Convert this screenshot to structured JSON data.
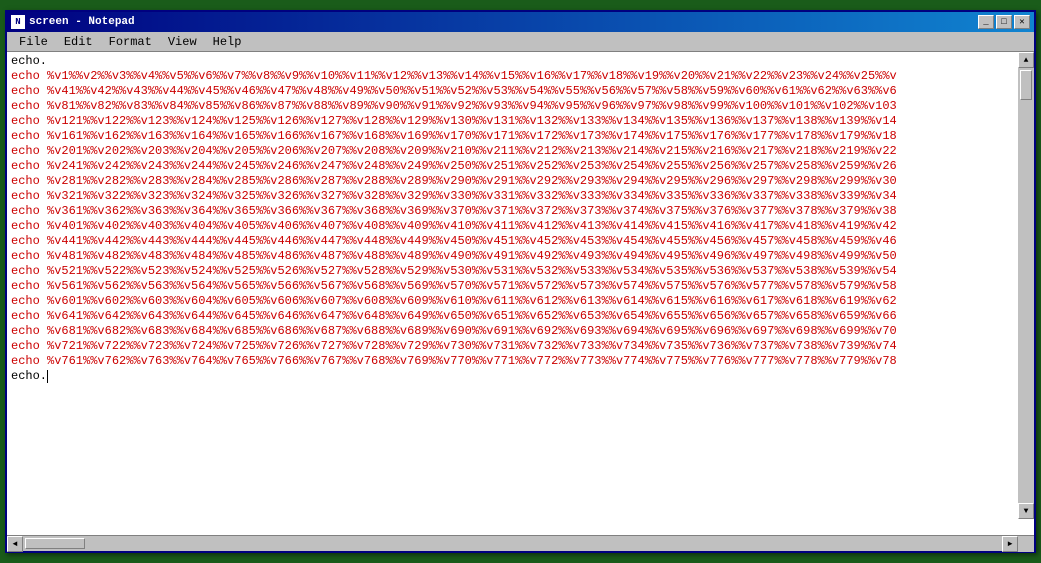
{
  "window": {
    "title": "screen - Notepad",
    "icon": "N"
  },
  "title_buttons": {
    "minimize": "_",
    "restore": "□",
    "close": "✕"
  },
  "menu": {
    "items": [
      "File",
      "Edit",
      "Format",
      "View",
      "Help"
    ]
  },
  "content": {
    "lines": [
      {
        "text": "echo.",
        "red": false
      },
      {
        "text": "echo   %v1%%v2%%v3%%v4%%v5%%v6%%v7%%v8%%v9%%v10%%v11%%v12%%v13%%v14%%v15%%v16%%v17%%v18%%v19%%v20%%v21%%v22%%v23%%v24%%v25%%v",
        "red": true
      },
      {
        "text": "echo   %v41%%v42%%v43%%v44%%v45%%v46%%v47%%v48%%v49%%v50%%v51%%v52%%v53%%v54%%v55%%v56%%v57%%v58%%v59%%v60%%v61%%v62%%v63%%v6",
        "red": true
      },
      {
        "text": "echo   %v81%%v82%%v83%%v84%%v85%%v86%%v87%%v88%%v89%%v90%%v91%%v92%%v93%%v94%%v95%%v96%%v97%%v98%%v99%%v100%%v101%%v102%%v103",
        "red": true
      },
      {
        "text": "echo   %v121%%v122%%v123%%v124%%v125%%v126%%v127%%v128%%v129%%v130%%v131%%v132%%v133%%v134%%v135%%v136%%v137%%v138%%v139%%v14",
        "red": true
      },
      {
        "text": "echo   %v161%%v162%%v163%%v164%%v165%%v166%%v167%%v168%%v169%%v170%%v171%%v172%%v173%%v174%%v175%%v176%%v177%%v178%%v179%%v18",
        "red": true
      },
      {
        "text": "echo   %v201%%v202%%v203%%v204%%v205%%v206%%v207%%v208%%v209%%v210%%v211%%v212%%v213%%v214%%v215%%v216%%v217%%v218%%v219%%v22",
        "red": true
      },
      {
        "text": "echo   %v241%%v242%%v243%%v244%%v245%%v246%%v247%%v248%%v249%%v250%%v251%%v252%%v253%%v254%%v255%%v256%%v257%%v258%%v259%%v26",
        "red": true
      },
      {
        "text": "echo   %v281%%v282%%v283%%v284%%v285%%v286%%v287%%v288%%v289%%v290%%v291%%v292%%v293%%v294%%v295%%v296%%v297%%v298%%v299%%v30",
        "red": true
      },
      {
        "text": "echo   %v321%%v322%%v323%%v324%%v325%%v326%%v327%%v328%%v329%%v330%%v331%%v332%%v333%%v334%%v335%%v336%%v337%%v338%%v339%%v34",
        "red": true
      },
      {
        "text": "echo   %v361%%v362%%v363%%v364%%v365%%v366%%v367%%v368%%v369%%v370%%v371%%v372%%v373%%v374%%v375%%v376%%v377%%v378%%v379%%v38",
        "red": true
      },
      {
        "text": "echo   %v401%%v402%%v403%%v404%%v405%%v406%%v407%%v408%%v409%%v410%%v411%%v412%%v413%%v414%%v415%%v416%%v417%%v418%%v419%%v42",
        "red": true
      },
      {
        "text": "echo   %v441%%v442%%v443%%v444%%v445%%v446%%v447%%v448%%v449%%v450%%v451%%v452%%v453%%v454%%v455%%v456%%v457%%v458%%v459%%v46",
        "red": true
      },
      {
        "text": "echo   %v481%%v482%%v483%%v484%%v485%%v486%%v487%%v488%%v489%%v490%%v491%%v492%%v493%%v494%%v495%%v496%%v497%%v498%%v499%%v50",
        "red": true
      },
      {
        "text": "echo   %v521%%v522%%v523%%v524%%v525%%v526%%v527%%v528%%v529%%v530%%v531%%v532%%v533%%v534%%v535%%v536%%v537%%v538%%v539%%v54",
        "red": true
      },
      {
        "text": "echo   %v561%%v562%%v563%%v564%%v565%%v566%%v567%%v568%%v569%%v570%%v571%%v572%%v573%%v574%%v575%%v576%%v577%%v578%%v579%%v58",
        "red": true
      },
      {
        "text": "echo   %v601%%v602%%v603%%v604%%v605%%v606%%v607%%v608%%v609%%v610%%v611%%v612%%v613%%v614%%v615%%v616%%v617%%v618%%v619%%v62",
        "red": true
      },
      {
        "text": "echo   %v641%%v642%%v643%%v644%%v645%%v646%%v647%%v648%%v649%%v650%%v651%%v652%%v653%%v654%%v655%%v656%%v657%%v658%%v659%%v66",
        "red": true
      },
      {
        "text": "echo   %v681%%v682%%v683%%v684%%v685%%v686%%v687%%v688%%v689%%v690%%v691%%v692%%v693%%v694%%v695%%v696%%v697%%v698%%v699%%v70",
        "red": true
      },
      {
        "text": "echo   %v721%%v722%%v723%%v724%%v725%%v726%%v727%%v728%%v729%%v730%%v731%%v732%%v733%%v734%%v735%%v736%%v737%%v738%%v739%%v74",
        "red": true
      },
      {
        "text": "echo   %v761%%v762%%v763%%v764%%v765%%v766%%v767%%v768%%v769%%v770%%v771%%v772%%v773%%v774%%v775%%v776%%v777%%v778%%v779%%v78",
        "red": true
      },
      {
        "text": "echo.",
        "red": false
      }
    ]
  }
}
